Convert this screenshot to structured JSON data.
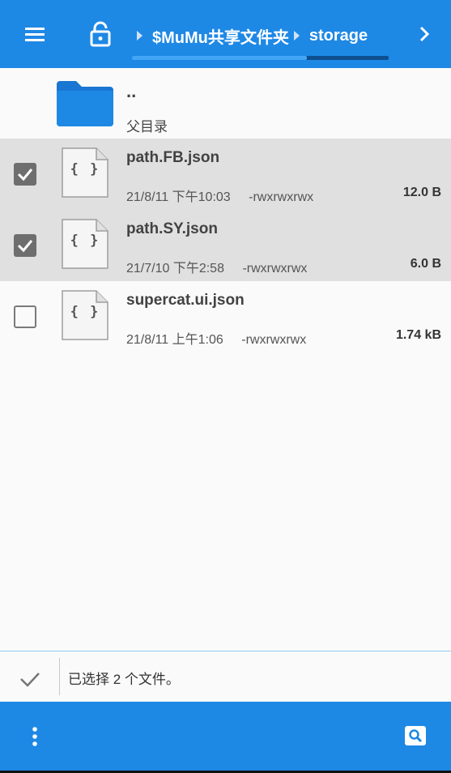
{
  "toolbar": {
    "breadcrumbs": [
      "$MuMu共享文件夹",
      "storage"
    ],
    "breadcrumb_scroll_fraction": 0.68
  },
  "parent_row": {
    "name": "..",
    "label": "父目录"
  },
  "files": [
    {
      "name": "path.FB.json",
      "date": "21/8/11 下午10:03",
      "perm": "-rwxrwxrwx",
      "size": "12.0 B",
      "selected": true,
      "icon": "json-file-icon"
    },
    {
      "name": "path.SY.json",
      "date": "21/7/10 下午2:58",
      "perm": "-rwxrwxrwx",
      "size": "6.0 B",
      "selected": true,
      "icon": "json-file-icon"
    },
    {
      "name": "supercat.ui.json",
      "date": "21/8/11 上午1:06",
      "perm": "-rwxrwxrwx",
      "size": "1.74 kB",
      "selected": false,
      "icon": "json-file-icon"
    }
  ],
  "file_icon_glyph": "{ }",
  "status": {
    "message": "已选择 2 个文件。"
  },
  "colors": {
    "primary": "#1e88e5",
    "selected_row": "#e0e0e0",
    "folder": "#1976d2"
  }
}
